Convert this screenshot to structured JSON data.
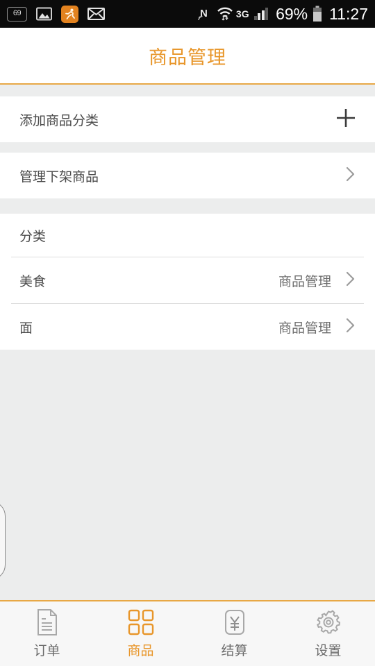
{
  "status_bar": {
    "left_icons": [
      {
        "name": "notification-count-badge",
        "label": "69"
      },
      {
        "name": "gallery-icon",
        "label": "image"
      },
      {
        "name": "running-app-icon",
        "label": "runner"
      },
      {
        "name": "mail-icon",
        "label": "envelope"
      }
    ],
    "nfc_label": "N",
    "network_type": "3G",
    "signal_bars_filled": 2,
    "signal_bars_total": 4,
    "battery_percent": "69%",
    "clock": "11:27"
  },
  "header": {
    "title": "商品管理",
    "accent_color": "#e8962a",
    "underline_color": "#e8a846"
  },
  "main": {
    "actions": [
      {
        "label": "添加商品分类",
        "icon": "plus-icon",
        "accessory": "plus"
      },
      {
        "label": "管理下架商品",
        "icon": "chevron-right-icon",
        "accessory": "chevron"
      }
    ],
    "section": {
      "title": "分类",
      "rows": [
        {
          "name": "美食",
          "action_label": "商品管理",
          "accessory": "chevron"
        },
        {
          "name": "面",
          "action_label": "商品管理",
          "accessory": "chevron"
        }
      ]
    }
  },
  "tabbar": {
    "items": [
      {
        "label": "订单",
        "icon": "document-icon",
        "active": false
      },
      {
        "label": "商品",
        "icon": "grid-icon",
        "active": true
      },
      {
        "label": "结算",
        "icon": "yuan-square-icon",
        "active": false
      },
      {
        "label": "设置",
        "icon": "gear-icon",
        "active": false
      }
    ],
    "active_color": "#e8962a",
    "inactive_color": "#6b6b6b"
  }
}
